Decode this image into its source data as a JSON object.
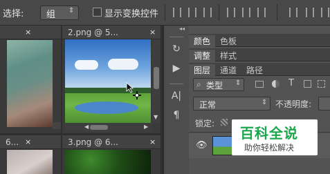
{
  "options_bar": {
    "auto_select_label": "选择:",
    "auto_select_value": "组",
    "show_transform_label": "显示变换控件"
  },
  "documents": [
    {
      "tab": "",
      "close": "×"
    },
    {
      "tab": "2.png @ 5...",
      "close": "×"
    },
    {
      "tab": "6...",
      "close": "×"
    },
    {
      "tab": "3.png @ 6...",
      "close": "×"
    }
  ],
  "tool_strip": {
    "collapse_glyph": "◂◂",
    "history_glyph": "↻",
    "play_glyph": "▶",
    "char_glyph": "A|",
    "para_glyph": "¶"
  },
  "panels": {
    "row1_tabs": [
      "颜色",
      "色板"
    ],
    "row2_tabs": [
      "调整",
      "样式"
    ],
    "row3_tabs": [
      "图层",
      "通道",
      "路径"
    ],
    "filter_kind": "类型",
    "blend_mode": "正常",
    "opacity_label": "不透明度:",
    "lock_label": "锁定:"
  },
  "watermark": {
    "title": "百科全说",
    "subtitle": "助你轻松解决"
  },
  "colors": {
    "options_bar": "#484848",
    "panel": "#535353",
    "watermark_green": "#1aa64a"
  }
}
